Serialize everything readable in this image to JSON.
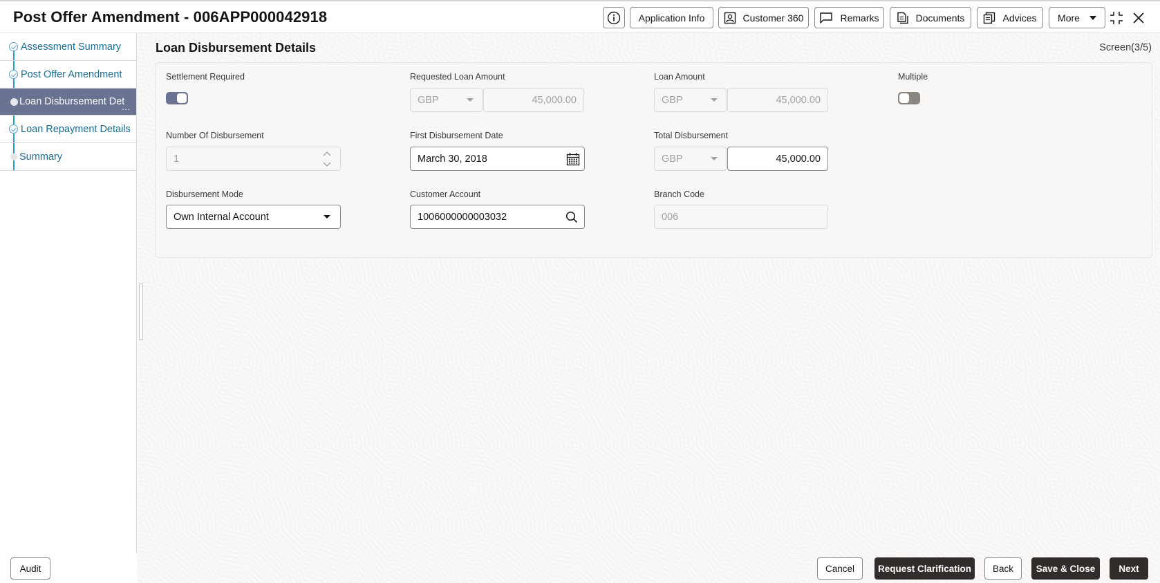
{
  "header": {
    "title": "Post Offer Amendment - 006APP000042918",
    "buttons": {
      "info_icon": "info-icon",
      "application_info": "Application Info",
      "customer_360": "Customer 360",
      "remarks": "Remarks",
      "documents": "Documents",
      "advices": "Advices",
      "more": "More"
    }
  },
  "sidebar": {
    "steps": [
      {
        "label": "Assessment Summary",
        "state": "done"
      },
      {
        "label": "Post Offer Amendment",
        "state": "done"
      },
      {
        "label": "Loan Disbursement Det",
        "state": "current",
        "ellipsis": "..."
      },
      {
        "label": "Loan Repayment Details",
        "state": "done"
      },
      {
        "label": "Summary",
        "state": "pending"
      }
    ]
  },
  "main": {
    "section_title": "Loan Disbursement Details",
    "screen_counter": "Screen(3/5)",
    "fields": {
      "settlement_required": {
        "label": "Settlement Required",
        "value": true
      },
      "requested_loan_amount": {
        "label": "Requested Loan Amount",
        "currency": "GBP",
        "value": "45,000.00"
      },
      "loan_amount": {
        "label": "Loan Amount",
        "currency": "GBP",
        "value": "45,000.00"
      },
      "multiple": {
        "label": "Multiple",
        "value": false
      },
      "number_of_disbursement": {
        "label": "Number Of Disbursement",
        "value": "1"
      },
      "first_disbursement_date": {
        "label": "First Disbursement Date",
        "value": "March 30, 2018"
      },
      "total_disbursement": {
        "label": "Total Disbursement",
        "currency": "GBP",
        "value": "45,000.00"
      },
      "disbursement_mode": {
        "label": "Disbursement Mode",
        "value": "Own Internal Account"
      },
      "customer_account": {
        "label": "Customer Account",
        "value": "1006000000003032"
      },
      "branch_code": {
        "label": "Branch Code",
        "value": "006"
      }
    }
  },
  "footer": {
    "audit": "Audit",
    "cancel": "Cancel",
    "request_clarification": "Request Clarification",
    "back": "Back",
    "save_close": "Save & Close",
    "next": "Next"
  },
  "colors": {
    "active_step_bg": "#6b7393",
    "link_text": "#1b6c8f",
    "primary_button": "#312d2a",
    "toggle_on": "#6b7393",
    "toggle_off": "#8b8680"
  }
}
